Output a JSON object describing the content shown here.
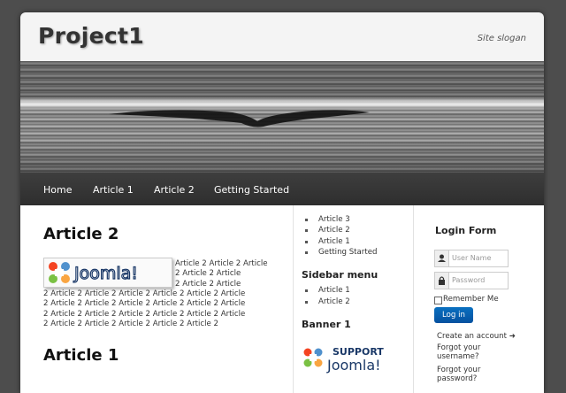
{
  "site": {
    "title": "Project1",
    "slogan": "Site slogan"
  },
  "nav": {
    "items": [
      "Home",
      "Article 1",
      "Article 2",
      "Getting Started"
    ]
  },
  "main": {
    "article2": {
      "title": "Article 2",
      "logo_text": "Joomla!",
      "lines": [
        "Article 2 Article 2 Article",
        "2 Article 2 Article",
        "2 Article 2 Article",
        "2 Article 2 Article 2 Article 2 Article 2 Article 2 Article",
        "2 Article 2 Article 2 Article 2 Article 2 Article 2 Article",
        "2 Article 2 Article 2 Article 2 Article 2 Article 2 Article",
        "2 Article 2 Article 2 Article 2 Article 2 Article 2"
      ]
    },
    "article1": {
      "title": "Article 1"
    }
  },
  "sidebar": {
    "top_list": [
      "Article 3",
      "Article 2",
      "Article 1",
      "Getting Started"
    ],
    "menu_heading": "Sidebar menu",
    "menu_items": [
      "Article 1",
      "Article 2"
    ],
    "banner_heading": "Banner 1",
    "banner_support": "SUPPORT",
    "banner_joomla": "Joomla!"
  },
  "login": {
    "title": "Login Form",
    "username_placeholder": "User Name",
    "password_placeholder": "Password",
    "remember": "Remember Me",
    "button": "Log in",
    "create_account": "Create an account",
    "forgot_username_1": "Forgot your",
    "forgot_username_2": "username?",
    "forgot_password_1": "Forgot your",
    "forgot_password_2": "password?"
  },
  "colors": {
    "navbar": "#333333",
    "button": "#0a62b0",
    "background": "#4d4d4d"
  }
}
